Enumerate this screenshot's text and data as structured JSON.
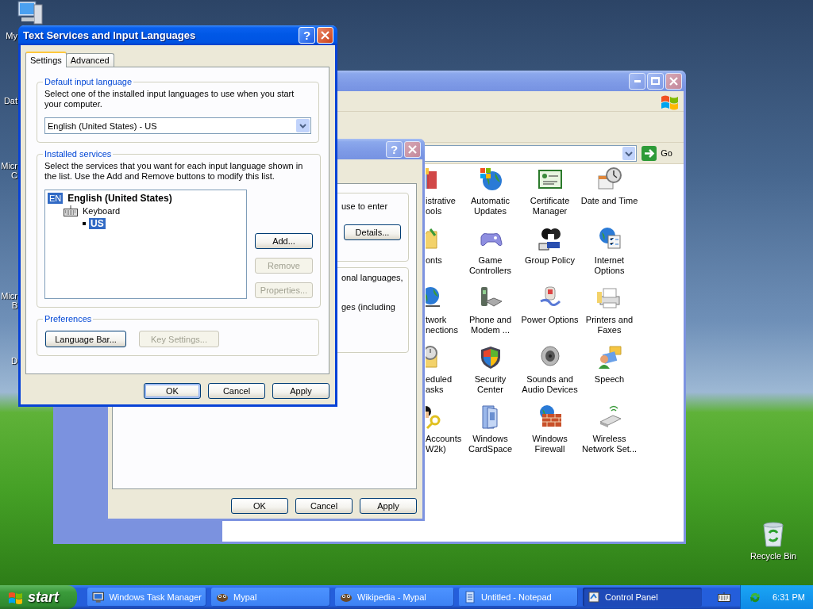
{
  "desktop_icons": [
    {
      "lines": [
        "My"
      ]
    },
    {
      "lines": [
        "Dat"
      ]
    },
    {
      "lines": [
        "Micr",
        "C"
      ]
    },
    {
      "lines": [
        "Micr",
        "B"
      ]
    },
    {
      "lines": [
        "D"
      ]
    }
  ],
  "recycle_bin": {
    "label": "Recycle Bin"
  },
  "control_panel": {
    "go_label": "Go",
    "items": [
      {
        "lines": [
          "istrative",
          "ools"
        ]
      },
      {
        "lines": [
          "Automatic",
          "Updates"
        ]
      },
      {
        "lines": [
          "Certificate",
          "Manager"
        ]
      },
      {
        "lines": [
          "Date and Time"
        ]
      },
      {
        "lines": [
          "onts"
        ]
      },
      {
        "lines": [
          "Game",
          "Controllers"
        ]
      },
      {
        "lines": [
          "Group Policy"
        ]
      },
      {
        "lines": [
          "Internet",
          "Options"
        ]
      },
      {
        "lines": [
          "twork",
          "nections"
        ]
      },
      {
        "lines": [
          "Phone and",
          "Modem ..."
        ]
      },
      {
        "lines": [
          "Power Options"
        ]
      },
      {
        "lines": [
          "Printers and",
          "Faxes"
        ]
      },
      {
        "lines": [
          "eduled",
          "asks"
        ]
      },
      {
        "lines": [
          "Security",
          "Center"
        ]
      },
      {
        "lines": [
          "Sounds and",
          "Audio Devices"
        ]
      },
      {
        "lines": [
          "Speech"
        ]
      },
      {
        "lines": [
          "Accounts",
          "W2k)"
        ]
      },
      {
        "lines": [
          "Windows",
          "CardSpace"
        ]
      },
      {
        "lines": [
          "Windows",
          "Firewall"
        ]
      },
      {
        "lines": [
          "Wireless",
          "Network Set..."
        ]
      }
    ]
  },
  "regional_dialog": {
    "help_label": "?",
    "groups": [
      {
        "lines": [
          "use to enter"
        ],
        "button": "Details..."
      },
      {
        "lines": [
          "onal languages,",
          "ges (including"
        ]
      }
    ],
    "buttons": [
      "OK",
      "Cancel",
      "Apply"
    ]
  },
  "text_services_dialog": {
    "title": "Text Services and Input Languages",
    "help_label": "?",
    "tabs": [
      {
        "label": "Settings",
        "selected": true
      },
      {
        "label": "Advanced",
        "selected": false
      }
    ],
    "default_language": {
      "heading": "Default input language",
      "description": "Select one of the installed input languages to use when you start your computer.",
      "value": "English (United States) - US"
    },
    "installed_services": {
      "heading": "Installed services",
      "description": "Select the services that you want for each input language shown in the list. Use the Add and Remove buttons to modify this list.",
      "tree": [
        {
          "kind": "language",
          "badge": "EN",
          "label": "English (United States)",
          "selected": false,
          "children": [
            {
              "kind": "category",
              "label": "Keyboard",
              "selected": false,
              "children": [
                {
                  "kind": "layout",
                  "label": "US",
                  "selected": true
                }
              ]
            }
          ]
        }
      ],
      "buttons": [
        {
          "label": "Add...",
          "disabled": false
        },
        {
          "label": "Remove",
          "disabled": true
        },
        {
          "label": "Properties...",
          "disabled": true
        }
      ]
    },
    "preferences": {
      "heading": "Preferences",
      "buttons": [
        {
          "label": "Language Bar...",
          "disabled": false
        },
        {
          "label": "Key Settings...",
          "disabled": true
        }
      ]
    },
    "buttons": [
      {
        "label": "OK",
        "default": true
      },
      {
        "label": "Cancel",
        "default": false
      },
      {
        "label": "Apply",
        "default": false
      }
    ]
  },
  "taskbar": {
    "start_label": "start",
    "tasks": [
      {
        "label": "Windows Task Manager",
        "selected": false
      },
      {
        "label": "Mypal",
        "selected": false
      },
      {
        "label": "Wikipedia - Mypal",
        "selected": false
      },
      {
        "label": "Untitled - Notepad",
        "selected": false
      },
      {
        "label": "Control Panel",
        "selected": true
      }
    ],
    "clock": "6:31 PM"
  }
}
